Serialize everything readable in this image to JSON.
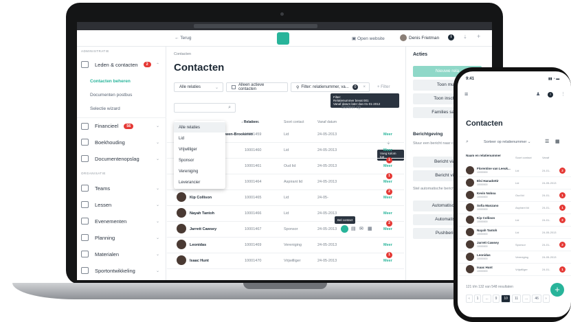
{
  "laptop": {
    "topbar": {
      "back": "Terug",
      "open_website": "Open website",
      "user": "Denis Frietman",
      "logo": "logo-badge"
    },
    "sidebar": {
      "section1": "ADMINISTRATIE",
      "leden": "Leden & contacten",
      "leden_badge": "2",
      "sub": [
        "Contacten beheren",
        "Documenten postbus",
        "Selectie wizard"
      ],
      "financieel": "Financieel",
      "financieel_badge": "56",
      "boekhouding": "Boekhouding",
      "documentenopslag": "Documentenopslag",
      "section2": "ORGANISATIE",
      "teams": "Teams",
      "lessen": "Lessen",
      "evenementen": "Evenementen",
      "planning": "Planning",
      "materialen": "Materialen",
      "sport": "Sportontwikkeling"
    },
    "main": {
      "breadcrumb": "Contacten",
      "title": "Contacten",
      "filter_select": "Alle relaties",
      "active_only": "Alleen actieve contacten",
      "filter_chip": "Filter: relatienummer, va...",
      "filter_count": "0",
      "filter_add": "+ Filter",
      "sort": "Sorteer op",
      "tooltip_filter": [
        "Filter:",
        "Relatienummer bevat 001",
        "Vanaf datum later dan 01-01-2012"
      ],
      "tooltip_col": "Voeg kolom toe",
      "tooltip_call": "Bel contact",
      "headers": {
        "relatie": "Relatienr.",
        "soort": "Soort contact",
        "vanaf": "Vanaf datum"
      },
      "dropdown": [
        "Alle relaties",
        "Lid",
        "Vrijwilliger",
        "Sponsor",
        "Vereniging",
        "Leverancier"
      ],
      "rows": [
        {
          "name": "Florentine van Leeuwen-Brookeren",
          "num": "10001459",
          "soort": "Lid",
          "date": "24-05-2013",
          "meer": "Meer",
          "badge": ""
        },
        {
          "name": "",
          "num": "10001460",
          "soort": "Lid",
          "date": "24-05-2013",
          "meer": "Meer",
          "badge": ""
        },
        {
          "name": "Kevin Noboa",
          "num": "10001461",
          "soort": "Oud lid",
          "date": "24-05-2013",
          "meer": "Meer",
          "badge": "1"
        },
        {
          "name": "Sofia Manzano",
          "num": "10001464",
          "soort": "Aspirant lid",
          "date": "24-05-2013",
          "meer": "Meer",
          "badge": "1"
        },
        {
          "name": "Kip Collison",
          "num": "10001465",
          "soort": "Lid",
          "date": "24-05-",
          "meer": "Meer",
          "badge": "2"
        },
        {
          "name": "Nayah Tantoh",
          "num": "10001466",
          "soort": "Lid",
          "date": "24-05-2013",
          "meer": "Meer",
          "badge": ""
        },
        {
          "name": "Jarrett Cawsey",
          "num": "10001467",
          "soort": "Sponsor",
          "date": "24-05-2013",
          "meer": "Meer",
          "badge": "2"
        },
        {
          "name": "Leonidas",
          "num": "10001469",
          "soort": "Vereniging",
          "date": "24-05-2013",
          "meer": "Meer",
          "badge": ""
        },
        {
          "name": "Isaac Hunt",
          "num": "10001470",
          "soort": "Vrijwilliger",
          "date": "24-05-2013",
          "meer": "Meer",
          "badge": "1"
        }
      ]
    },
    "actions": {
      "title": "Acties",
      "new": "Nieuwe rela",
      "mutatie": "Toon muta",
      "inschrijving": "Toon inschrijv",
      "families": "Families samen",
      "berichtgeving": "Berichtgeving",
      "info": "Stuur een bericht naar contacten.",
      "bericht_e": "Bericht via e-",
      "bericht_s": "Bericht via s",
      "auto_info": "Stel automatische berichtgeving in",
      "auto1": "Automatische e",
      "auto2": "Automatisch",
      "push": "Pushbericht"
    }
  },
  "phone": {
    "time": "9:41",
    "title": "Contacten",
    "sort": "Sorteer op relatienummer",
    "headers": {
      "naam": "Naam en relatienummer",
      "soort": "Soort contact",
      "vanaf": "Vanaf"
    },
    "rows": [
      {
        "name": "Florentine van Leeuk...",
        "num": "10000000",
        "soort": "Lid",
        "date": "24-01-",
        "badge": "2"
      },
      {
        "name": "Elsi Hanadottir",
        "num": "10000000",
        "soort": "Lid",
        "date": "24-05-2013",
        "badge": ""
      },
      {
        "name": "Kevin Noboa",
        "num": "10000000",
        "soort": "Oud lid",
        "date": "24-01-",
        "badge": "1"
      },
      {
        "name": "Sofia Manzano",
        "num": "10000000",
        "soort": "Aspirant lid",
        "date": "24-01-",
        "badge": "1"
      },
      {
        "name": "Kip Collison",
        "num": "10000000",
        "soort": "Lid",
        "date": "24-01-",
        "badge": "2"
      },
      {
        "name": "Nayah Tantoh",
        "num": "10000000",
        "soort": "Lid",
        "date": "24-05-2013",
        "badge": ""
      },
      {
        "name": "Jarrett Cawsey",
        "num": "10000000",
        "soort": "Sponsor",
        "date": "24-01-",
        "badge": "2"
      },
      {
        "name": "Leonidas",
        "num": "10000000",
        "soort": "Vereniging",
        "date": "24-05-2013",
        "badge": ""
      },
      {
        "name": "Isaac Hunt",
        "num": "10000000",
        "soort": "Vrijwilliger",
        "date": "24-01-",
        "badge": "1"
      }
    ],
    "results": "121 t/m 132 van 548 resultaten",
    "pages": [
      "‹",
      "1",
      "...",
      "9",
      "10",
      "11",
      "...",
      "46",
      "›"
    ],
    "active_page": "10",
    "fab": "+"
  },
  "colors": {
    "accent": "#28b49a",
    "badge": "#e53935"
  }
}
